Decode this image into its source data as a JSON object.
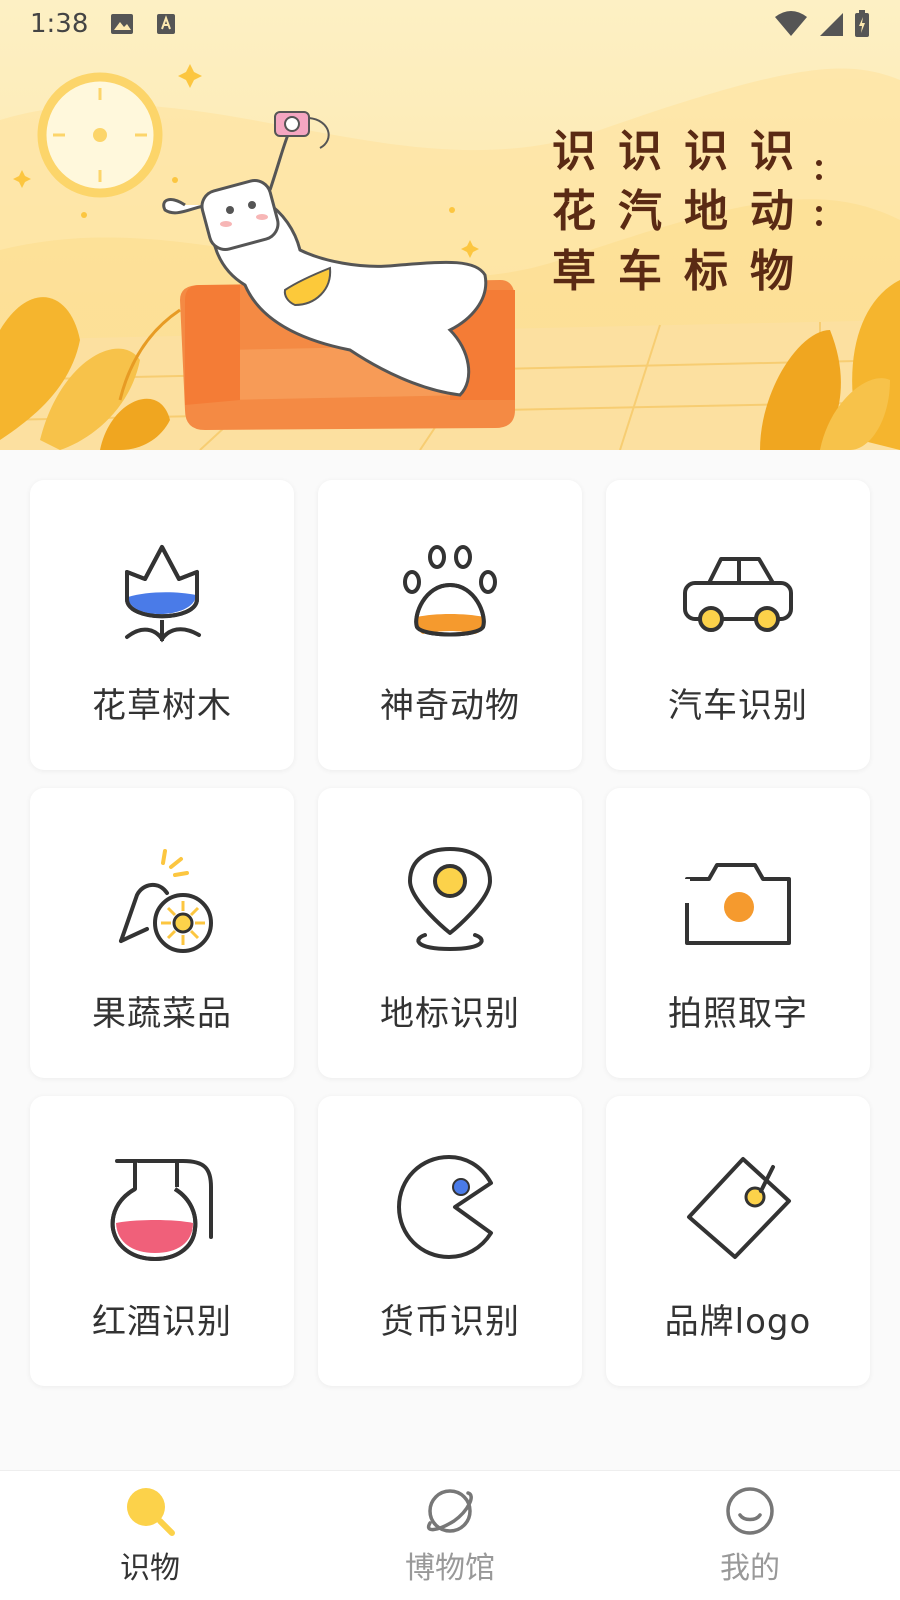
{
  "status_bar": {
    "time": "1:38"
  },
  "hero": {
    "title_grid": [
      [
        "识",
        "识",
        "识",
        "识"
      ],
      [
        "花",
        "汽",
        "地",
        "动"
      ],
      [
        "草",
        "车",
        "标",
        "物"
      ]
    ]
  },
  "categories": [
    {
      "label": "花草树木",
      "icon": "flower-icon"
    },
    {
      "label": "神奇动物",
      "icon": "paw-icon"
    },
    {
      "label": "汽车识别",
      "icon": "car-icon"
    },
    {
      "label": "果蔬菜品",
      "icon": "fruit-icon"
    },
    {
      "label": "地标识别",
      "icon": "location-pin-icon"
    },
    {
      "label": "拍照取字",
      "icon": "camera-icon"
    },
    {
      "label": "红酒识别",
      "icon": "wine-jug-icon"
    },
    {
      "label": "货币识别",
      "icon": "coin-icon"
    },
    {
      "label": "品牌logo",
      "icon": "tag-icon"
    }
  ],
  "bottom_nav": [
    {
      "label": "识物",
      "icon": "search-icon",
      "active": true
    },
    {
      "label": "博物馆",
      "icon": "planet-icon",
      "active": false
    },
    {
      "label": "我的",
      "icon": "smile-icon",
      "active": false
    }
  ],
  "colors": {
    "accent_yellow": "#fcd24a",
    "accent_orange": "#f59a2e",
    "accent_blue": "#4a7be8",
    "accent_pink": "#f0607a",
    "title_brown": "#5a2a14"
  }
}
